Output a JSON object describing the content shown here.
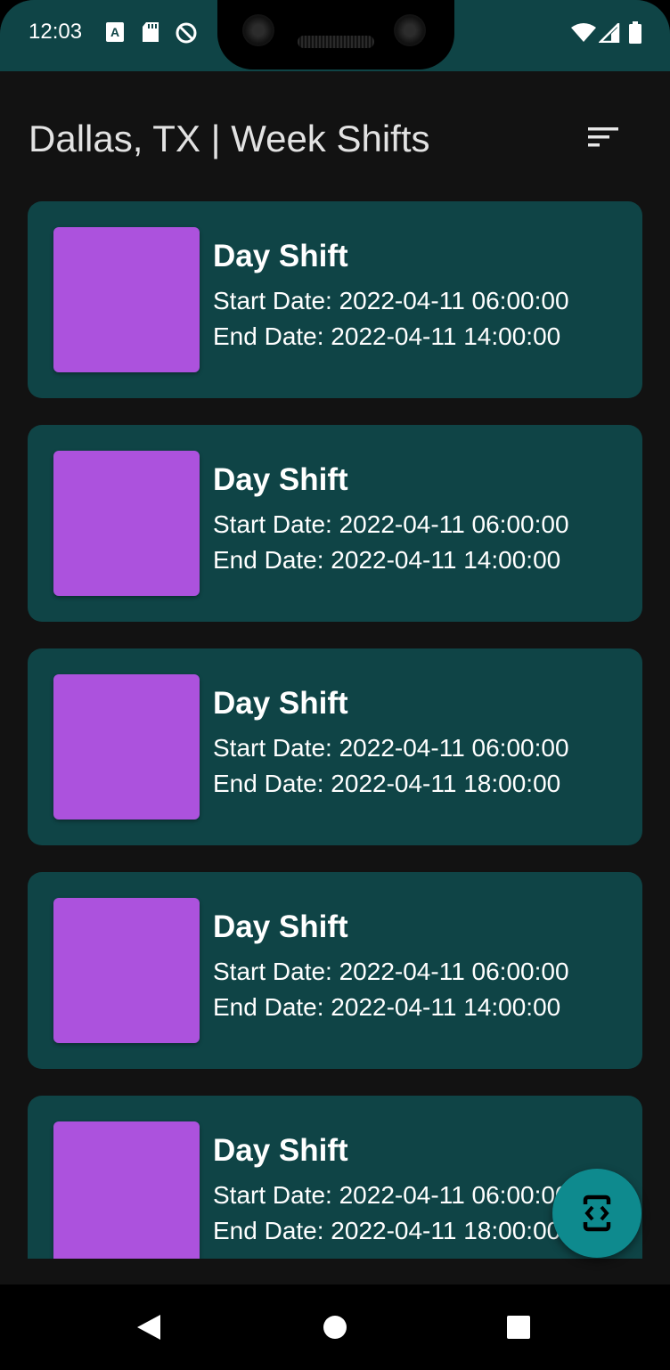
{
  "status_bar": {
    "time": "12:03",
    "left_icons": [
      "accessibility-icon",
      "sd-card-icon",
      "no-sync-icon"
    ],
    "right_icons": [
      "wifi-icon",
      "cell-signal-icon",
      "battery-icon"
    ]
  },
  "header": {
    "title": "Dallas, TX | Week Shifts",
    "sort_icon": "sort-icon"
  },
  "shifts": [
    {
      "title": "Day Shift",
      "start": "Start Date: 2022-04-11 06:00:00",
      "end": "End Date: 2022-04-11 14:00:00"
    },
    {
      "title": "Day Shift",
      "start": "Start Date: 2022-04-11 06:00:00",
      "end": "End Date: 2022-04-11 14:00:00"
    },
    {
      "title": "Day Shift",
      "start": "Start Date: 2022-04-11 06:00:00",
      "end": "End Date: 2022-04-11 18:00:00"
    },
    {
      "title": "Day Shift",
      "start": "Start Date: 2022-04-11 06:00:00",
      "end": "End Date: 2022-04-11 14:00:00"
    },
    {
      "title": "Day Shift",
      "start": "Start Date: 2022-04-11 06:00:00",
      "end": "End Date: 2022-04-11 18:00:00"
    }
  ],
  "fab": {
    "icon": "code-brackets-icon"
  },
  "nav_bar": {
    "icons": [
      "back-icon",
      "home-icon",
      "recents-icon"
    ]
  },
  "colors": {
    "background": "#121212",
    "card": "#0f4446",
    "thumbnail": "#ac52dd",
    "fab": "#0e8a8e",
    "text": "#ffffff"
  }
}
